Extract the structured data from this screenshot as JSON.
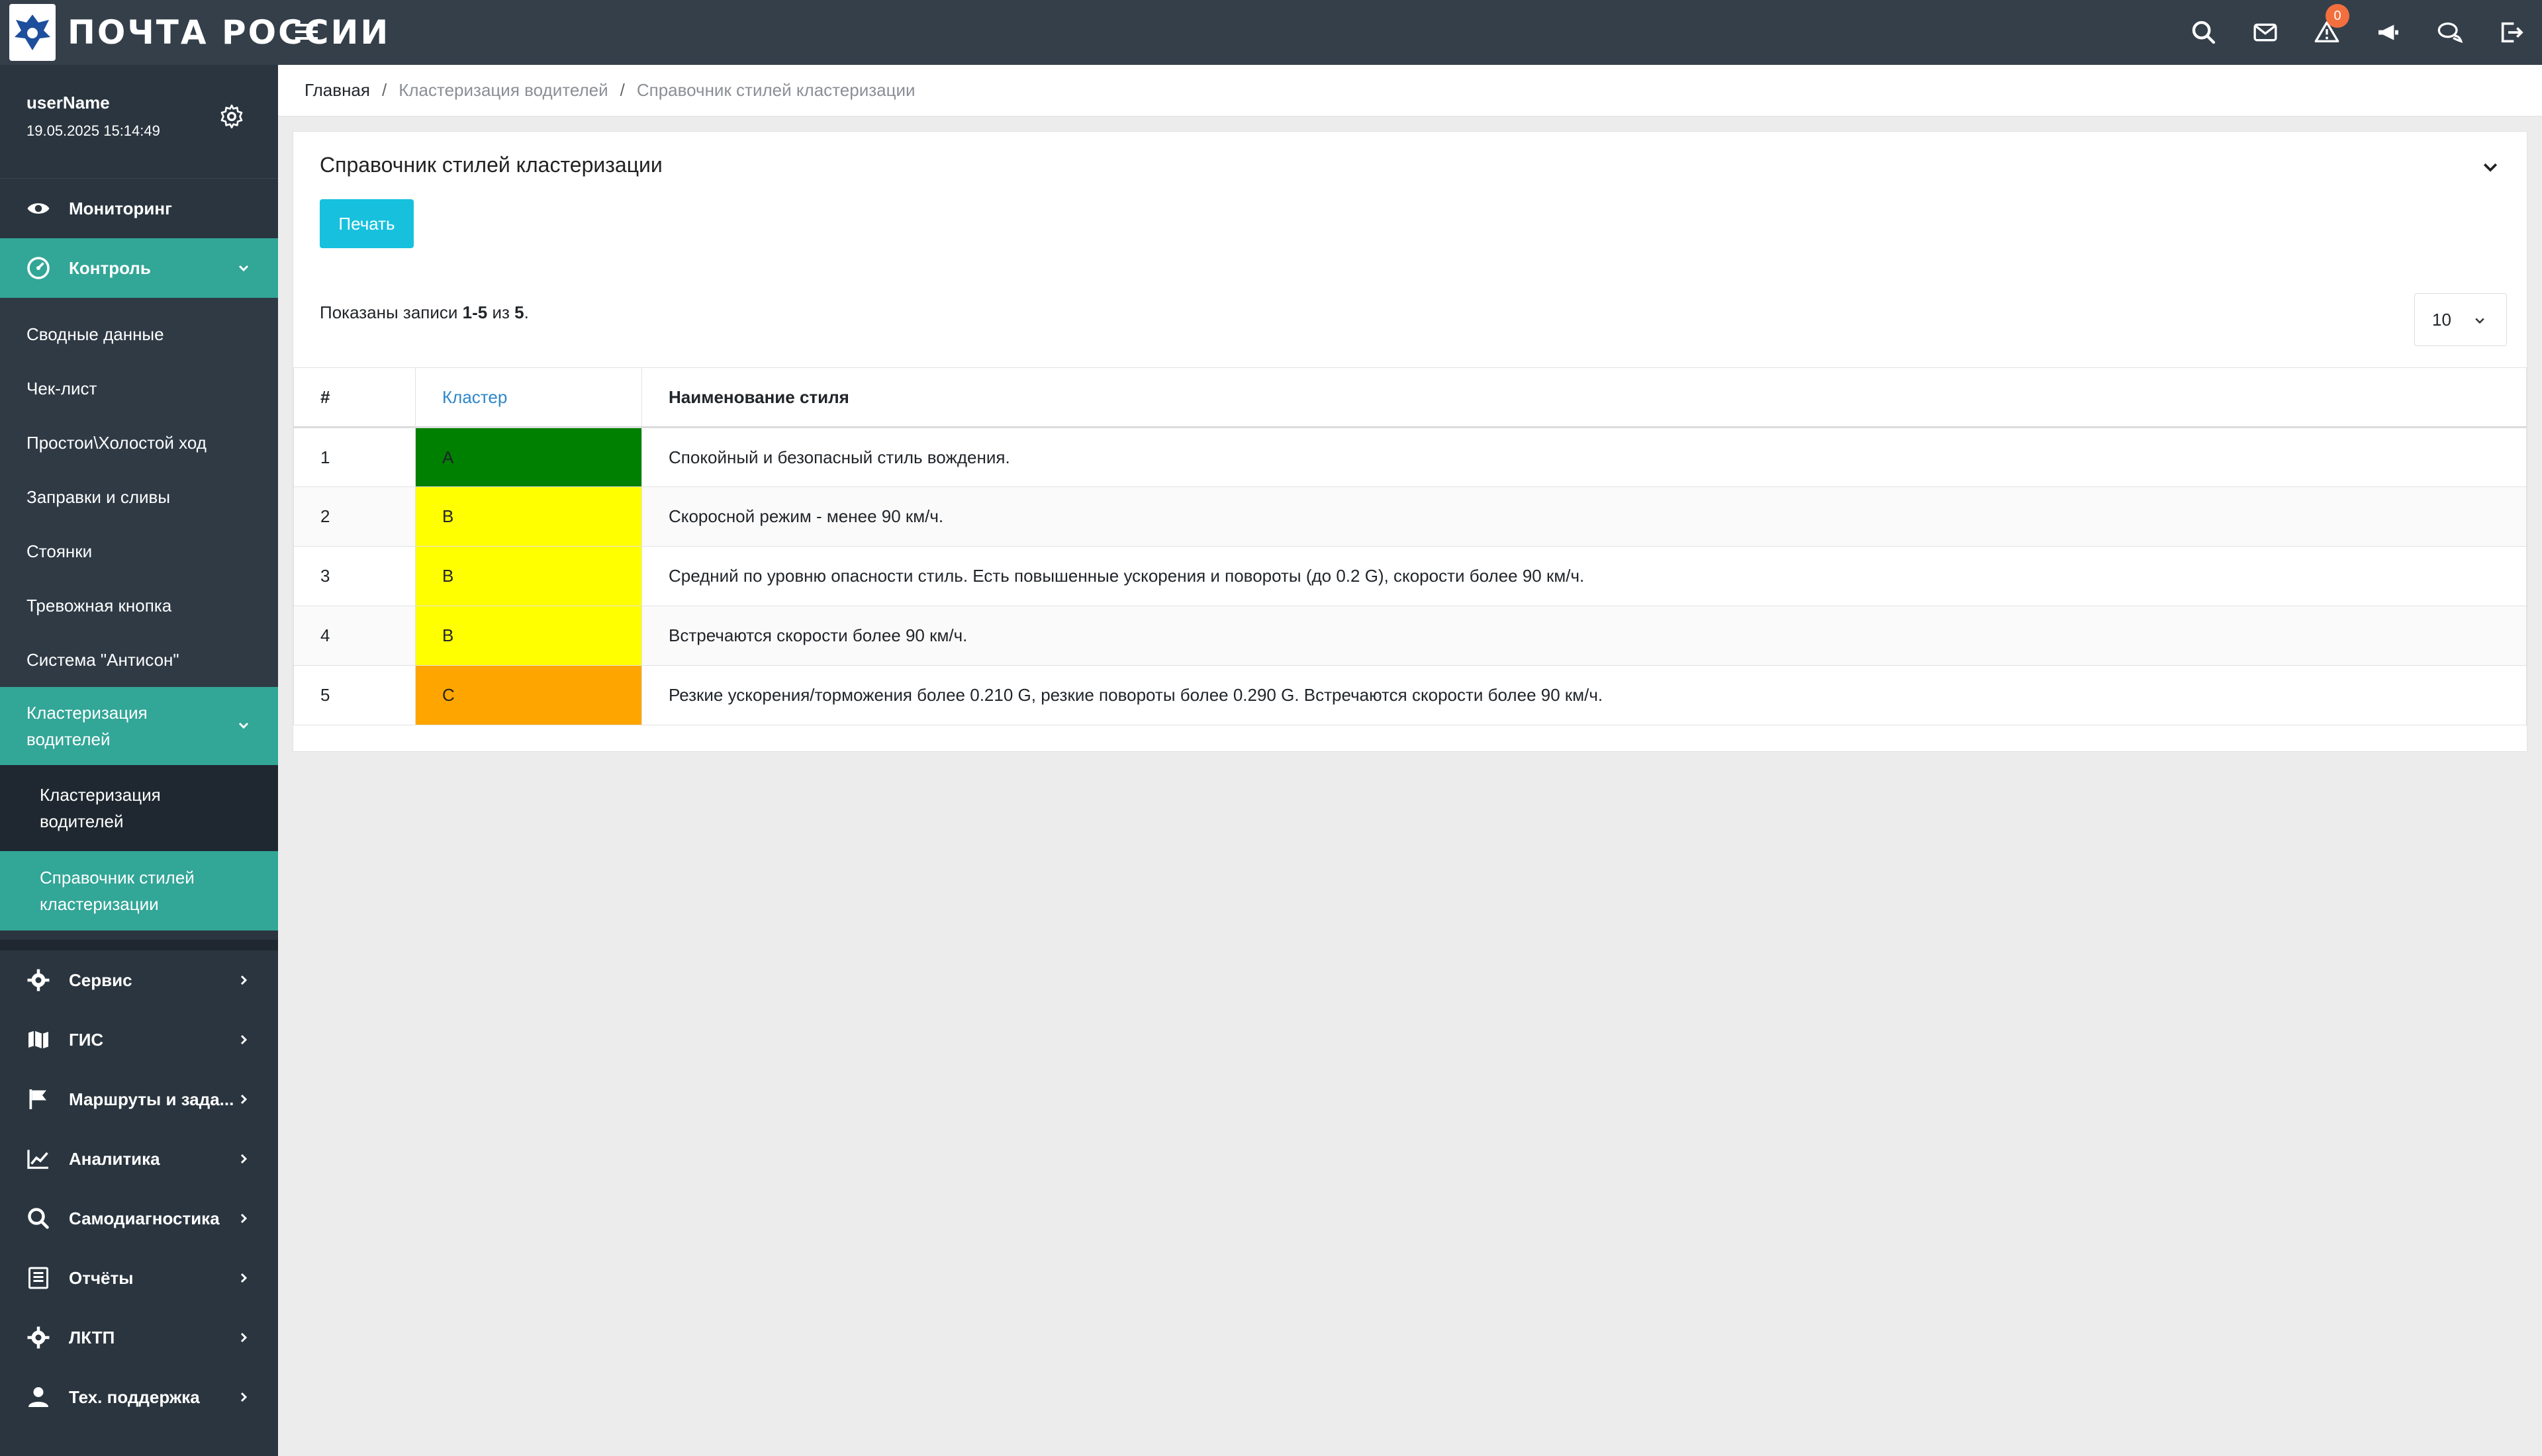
{
  "app": {
    "logo_text": "ПОЧТА РОССИИ"
  },
  "header": {
    "icons": [
      {
        "name": "search-icon"
      },
      {
        "name": "mail-icon"
      },
      {
        "name": "warning-icon",
        "badge": "0"
      },
      {
        "name": "megaphone-icon"
      },
      {
        "name": "chat-icon"
      },
      {
        "name": "logout-icon"
      }
    ]
  },
  "user": {
    "name": "userName",
    "datetime": "19.05.2025 15:14:49"
  },
  "sidebar": {
    "monitoring": "Мониторинг",
    "control": "Контроль",
    "control_items": [
      "Сводные данные",
      "Чек-лист",
      "Простои\\Холостой ход",
      "Заправки и сливы",
      "Стоянки",
      "Тревожная кнопка",
      "Система \"Антисон\""
    ],
    "clustering": "Кластеризация водителей",
    "clustering_items": [
      "Кластеризация водителей",
      "Справочник стилей кластеризации"
    ],
    "bottom_items": [
      {
        "label": "Сервис",
        "icon": "gear-icon"
      },
      {
        "label": "ГИС",
        "icon": "map-icon"
      },
      {
        "label": "Маршруты и зада...",
        "icon": "flag-icon"
      },
      {
        "label": "Аналитика",
        "icon": "chart-icon"
      },
      {
        "label": "Самодиагностика",
        "icon": "search-icon"
      },
      {
        "label": "Отчёты",
        "icon": "report-icon"
      },
      {
        "label": "ЛКТП",
        "icon": "gear-icon"
      },
      {
        "label": "Тех. поддержка",
        "icon": "user-icon"
      }
    ]
  },
  "breadcrumb": {
    "home": "Главная",
    "level2": "Кластеризация водителей",
    "current": "Справочник стилей кластеризации",
    "sep": "/"
  },
  "card": {
    "title": "Справочник стилей кластеризации",
    "print_label": "Печать",
    "summary_prefix": "Показаны записи ",
    "summary_range": "1-5",
    "summary_mid": " из ",
    "summary_total": "5",
    "summary_suffix": ".",
    "page_size": "10"
  },
  "table": {
    "headers": [
      "#",
      "Кластер",
      "Наименование стиля"
    ],
    "rows": [
      {
        "num": "1",
        "cluster": "A",
        "color": "#008000",
        "name": "Спокойный и безопасный стиль вождения."
      },
      {
        "num": "2",
        "cluster": "B",
        "color": "#ffff00",
        "name": "Скоросной режим - менее 90 км/ч."
      },
      {
        "num": "3",
        "cluster": "B",
        "color": "#ffff00",
        "name": "Средний по уровню опасности стиль. Есть повышенные ускорения и повороты (до 0.2 G), скорости более 90 км/ч."
      },
      {
        "num": "4",
        "cluster": "B",
        "color": "#ffff00",
        "name": "Встречаются скорости более 90 км/ч."
      },
      {
        "num": "5",
        "cluster": "C",
        "color": "#ffa500",
        "name": "Резкие ускорения/торможения более 0.210 G, резкие повороты более 0.290 G. Встречаются скорости более 90 км/ч."
      }
    ]
  },
  "colors": {
    "accent": "#32a697",
    "topbar": "#343f4a",
    "sidebar": "#2a353f",
    "button": "#17c1de",
    "link": "#2f86c8"
  }
}
